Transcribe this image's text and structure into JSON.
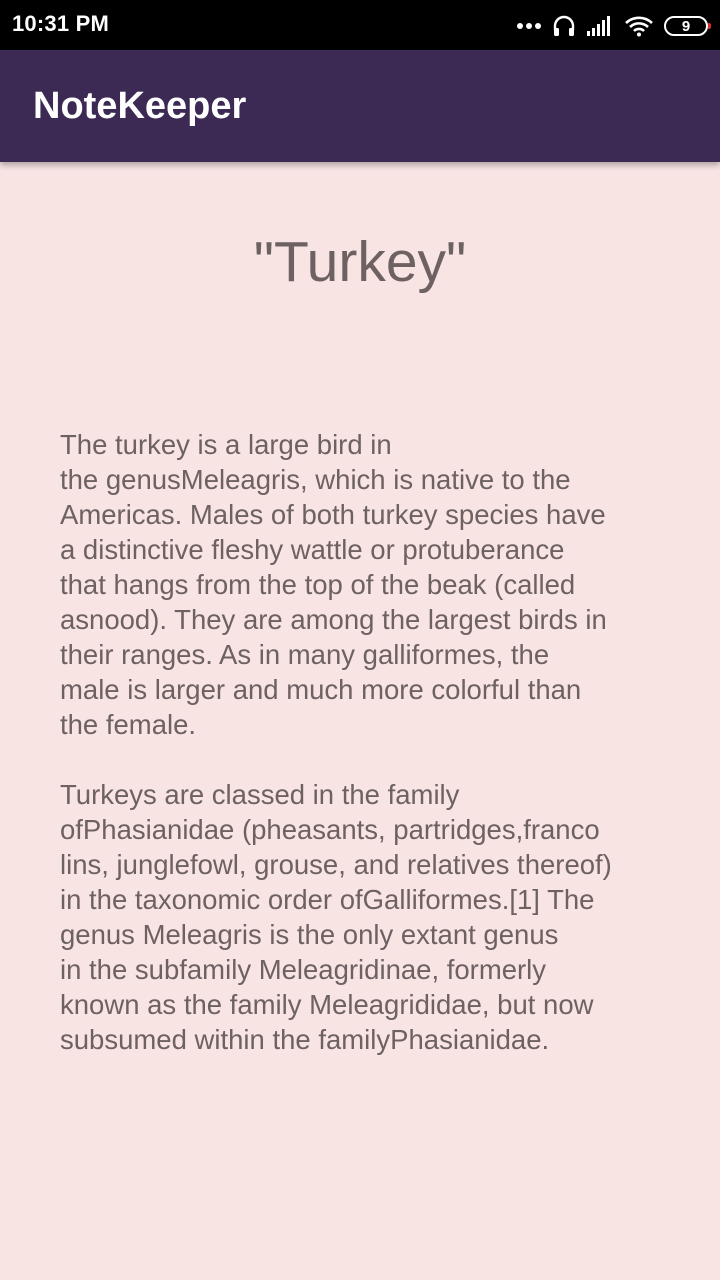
{
  "status_bar": {
    "time": "10:31 PM",
    "battery_level": "9",
    "icons": [
      "more-dots-icon",
      "headset-icon",
      "signal-icon",
      "wifi-icon",
      "battery-icon"
    ]
  },
  "app_bar": {
    "title": "NoteKeeper",
    "color": "#3c2a54"
  },
  "note": {
    "title": "\"Turkey\"",
    "paragraphs": [
      {
        "lines": [
          "The turkey is a large bird in",
          "the genusMeleagris, which is native to the",
          "Americas. Males of both turkey species have",
          "a distinctive fleshy wattle or protuberance",
          "that hangs from the top of the beak (called",
          "asnood). They are among the largest birds in",
          "their ranges. As in many galliformes, the",
          "male is larger and much more colorful than",
          "the female."
        ]
      },
      {
        "lines": [
          "Turkeys are classed in the family",
          "ofPhasianidae (pheasants, partridges,franco",
          "lins, junglefowl, grouse, and relatives thereof)",
          "in the taxonomic order ofGalliformes.[1] The",
          "genus Meleagris is the only extant genus",
          "in the subfamily Meleagridinae, formerly",
          "known as the family Meleagrididae, but now",
          "subsumed within the familyPhasianidae."
        ]
      }
    ]
  },
  "colors": {
    "background": "#f9e4e4",
    "text": "#6d6162",
    "status_bar": "#000000"
  }
}
